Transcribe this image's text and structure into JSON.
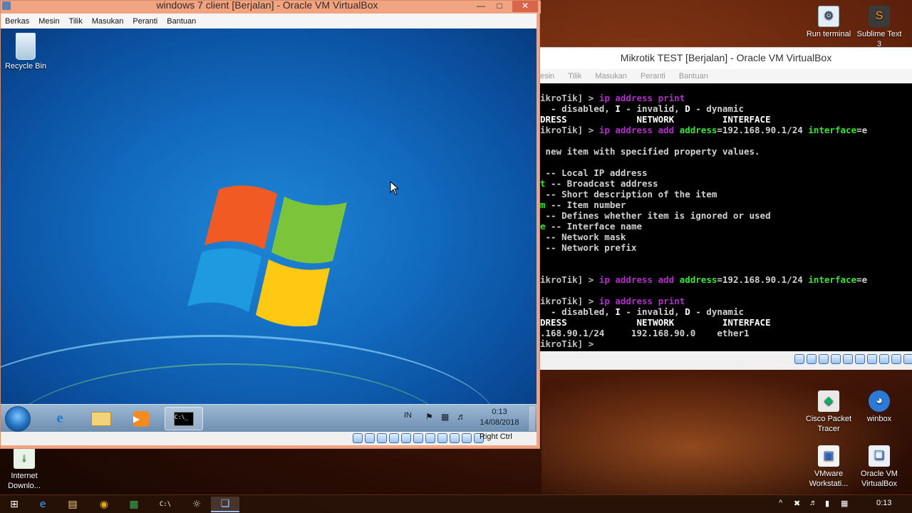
{
  "host": {
    "desktop_icons": [
      {
        "label": "Run terminal",
        "icon": "run-terminal-icon"
      },
      {
        "label": "Sublime Text 3",
        "icon": "sublime-text-icon"
      },
      {
        "label": "Cisco Packet Tracer",
        "icon": "cisco-packet-tracer-icon"
      },
      {
        "label": "winbox",
        "icon": "winbox-icon"
      },
      {
        "label": "VMware Workstati...",
        "icon": "vmware-icon"
      },
      {
        "label": "Oracle VM VirtualBox",
        "icon": "virtualbox-icon"
      },
      {
        "label": "Internet Downlo...",
        "icon": "internet-download-manager-icon"
      }
    ],
    "taskbar": {
      "apps": [
        "windows-start-icon",
        "edge-icon",
        "file-explorer-icon",
        "chrome-icon",
        "excel-icon",
        "cmd-icon",
        "wifi-tool-icon",
        "virtualbox-icon"
      ],
      "tray": {
        "chevron": "^",
        "clock": "0:13"
      }
    }
  },
  "vm_client": {
    "title": "windows 7 client [Berjalan] - Oracle VM VirtualBox",
    "menu": [
      "Berkas",
      "Mesin",
      "Tilik",
      "Masukan",
      "Peranti",
      "Bantuan"
    ],
    "desktop": {
      "recycle_bin_label": "Recycle Bin"
    },
    "taskbar": {
      "language": "IN",
      "time": "0:13",
      "date": "14/08/2018"
    },
    "status": {
      "host_key": "Right Ctrl"
    }
  },
  "vm_mikrotik": {
    "title": "Mikrotik TEST [Berjalan] - Oracle VM VirtualBox",
    "menu": [
      "esin",
      "Tilik",
      "Masukan",
      "Peranti",
      "Bantuan"
    ],
    "terminal_lines": [
      [
        {
          "t": "ikroTik] > ",
          "c": "c-prompt"
        },
        {
          "t": "ip address ",
          "c": "c-purple"
        },
        {
          "t": "print",
          "c": "c-purple"
        }
      ],
      [
        {
          "t": "  - disabled, ",
          "c": "c-grey"
        },
        {
          "t": "I",
          "c": "c-white"
        },
        {
          "t": " - invalid, ",
          "c": "c-grey"
        },
        {
          "t": "D",
          "c": "c-white"
        },
        {
          "t": " - dynamic",
          "c": "c-grey"
        }
      ],
      [
        {
          "t": "DRESS             NETWORK         INTERFACE",
          "c": "c-white"
        }
      ],
      [
        {
          "t": "ikroTik] > ",
          "c": "c-prompt"
        },
        {
          "t": "ip address add ",
          "c": "c-purple"
        },
        {
          "t": "address",
          "c": "c-green"
        },
        {
          "t": "=192.168.90.1/24 ",
          "c": "c-grey"
        },
        {
          "t": "interface",
          "c": "c-green"
        },
        {
          "t": "=e",
          "c": "c-grey"
        }
      ],
      [
        {
          "t": "",
          "c": "c-grey"
        }
      ],
      [
        {
          "t": " new item with specified property values.",
          "c": "c-grey"
        }
      ],
      [
        {
          "t": "",
          "c": "c-grey"
        }
      ],
      [
        {
          "t": " -- Local IP address",
          "c": "c-grey"
        }
      ],
      [
        {
          "t": "t",
          "c": "c-green"
        },
        {
          "t": " -- Broadcast address",
          "c": "c-grey"
        }
      ],
      [
        {
          "t": " -- Short description of the item",
          "c": "c-grey"
        }
      ],
      [
        {
          "t": "m",
          "c": "c-green"
        },
        {
          "t": " -- Item number",
          "c": "c-grey"
        }
      ],
      [
        {
          "t": " -- Defines whether item is ignored or used",
          "c": "c-grey"
        }
      ],
      [
        {
          "t": "e",
          "c": "c-green"
        },
        {
          "t": " -- Interface name",
          "c": "c-grey"
        }
      ],
      [
        {
          "t": " -- Network mask",
          "c": "c-grey"
        }
      ],
      [
        {
          "t": " -- Network prefix",
          "c": "c-grey"
        }
      ],
      [
        {
          "t": "",
          "c": "c-grey"
        }
      ],
      [
        {
          "t": "",
          "c": "c-grey"
        }
      ],
      [
        {
          "t": "ikroTik] > ",
          "c": "c-prompt"
        },
        {
          "t": "ip address add ",
          "c": "c-purple"
        },
        {
          "t": "address",
          "c": "c-green"
        },
        {
          "t": "=192.168.90.1/24 ",
          "c": "c-grey"
        },
        {
          "t": "interface",
          "c": "c-green"
        },
        {
          "t": "=e",
          "c": "c-grey"
        }
      ],
      [
        {
          "t": "",
          "c": "c-grey"
        }
      ],
      [
        {
          "t": "ikroTik] > ",
          "c": "c-prompt"
        },
        {
          "t": "ip address ",
          "c": "c-purple"
        },
        {
          "t": "print",
          "c": "c-purple"
        }
      ],
      [
        {
          "t": "  - disabled, ",
          "c": "c-grey"
        },
        {
          "t": "I",
          "c": "c-white"
        },
        {
          "t": " - invalid, ",
          "c": "c-grey"
        },
        {
          "t": "D",
          "c": "c-white"
        },
        {
          "t": " - dynamic",
          "c": "c-grey"
        }
      ],
      [
        {
          "t": "DRESS             NETWORK         INTERFACE",
          "c": "c-white"
        }
      ],
      [
        {
          "t": ".168.90.1/24     192.168.90.0    ether1",
          "c": "c-grey"
        }
      ],
      [
        {
          "t": "ikroTik] > ",
          "c": "c-prompt"
        }
      ]
    ]
  },
  "colors": {
    "vm_client_frame": "#f0a482",
    "terminal_bg": "#000000",
    "cmd_purple": "#b030c8",
    "param_green": "#3ae53a"
  }
}
